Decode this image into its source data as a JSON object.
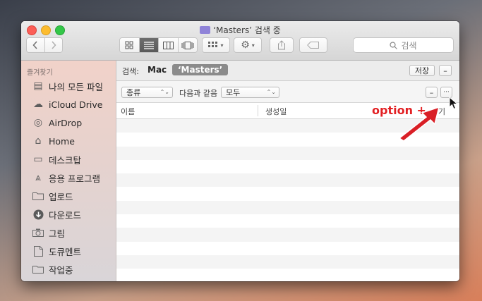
{
  "window": {
    "title": "‘Masters’ 검색 중"
  },
  "toolbar": {
    "back_icon": "chevron-left-icon",
    "forward_icon": "chevron-right-icon",
    "view_buttons": [
      "icon-view",
      "list-view",
      "column-view",
      "coverflow-view"
    ],
    "active_view": "list-view",
    "search_placeholder": "검색"
  },
  "sidebar": {
    "header": "즐겨찾기",
    "items": [
      {
        "label": "나의 모든 파일",
        "icon": "all-files-icon"
      },
      {
        "label": "iCloud Drive",
        "icon": "cloud-icon"
      },
      {
        "label": "AirDrop",
        "icon": "airdrop-icon"
      },
      {
        "label": "Home",
        "icon": "home-icon"
      },
      {
        "label": "데스크탑",
        "icon": "desktop-icon"
      },
      {
        "label": "응용 프로그램",
        "icon": "applications-icon"
      },
      {
        "label": "업로드",
        "icon": "folder-icon"
      },
      {
        "label": "다운로드",
        "icon": "download-icon"
      },
      {
        "label": "그림",
        "icon": "camera-icon"
      },
      {
        "label": "도큐멘트",
        "icon": "document-icon"
      },
      {
        "label": "작업중",
        "icon": "folder-icon"
      }
    ]
  },
  "scope_bar": {
    "label": "검색:",
    "scope_mac": "Mac",
    "scope_folder": "‘Masters’",
    "save_label": "저장",
    "remove_label": "–"
  },
  "criteria": {
    "attribute": "종류",
    "operator": "다음과 같음",
    "value": "모두",
    "remove_label": "–",
    "add_label": "···"
  },
  "columns": {
    "name": "이름",
    "created": "생성일",
    "third": "기"
  },
  "annotation": {
    "text": "option +"
  },
  "colors": {
    "accent_red": "#e22023",
    "active_segment": "#5f5f5f",
    "scope_selected": "#8b8b8b"
  }
}
